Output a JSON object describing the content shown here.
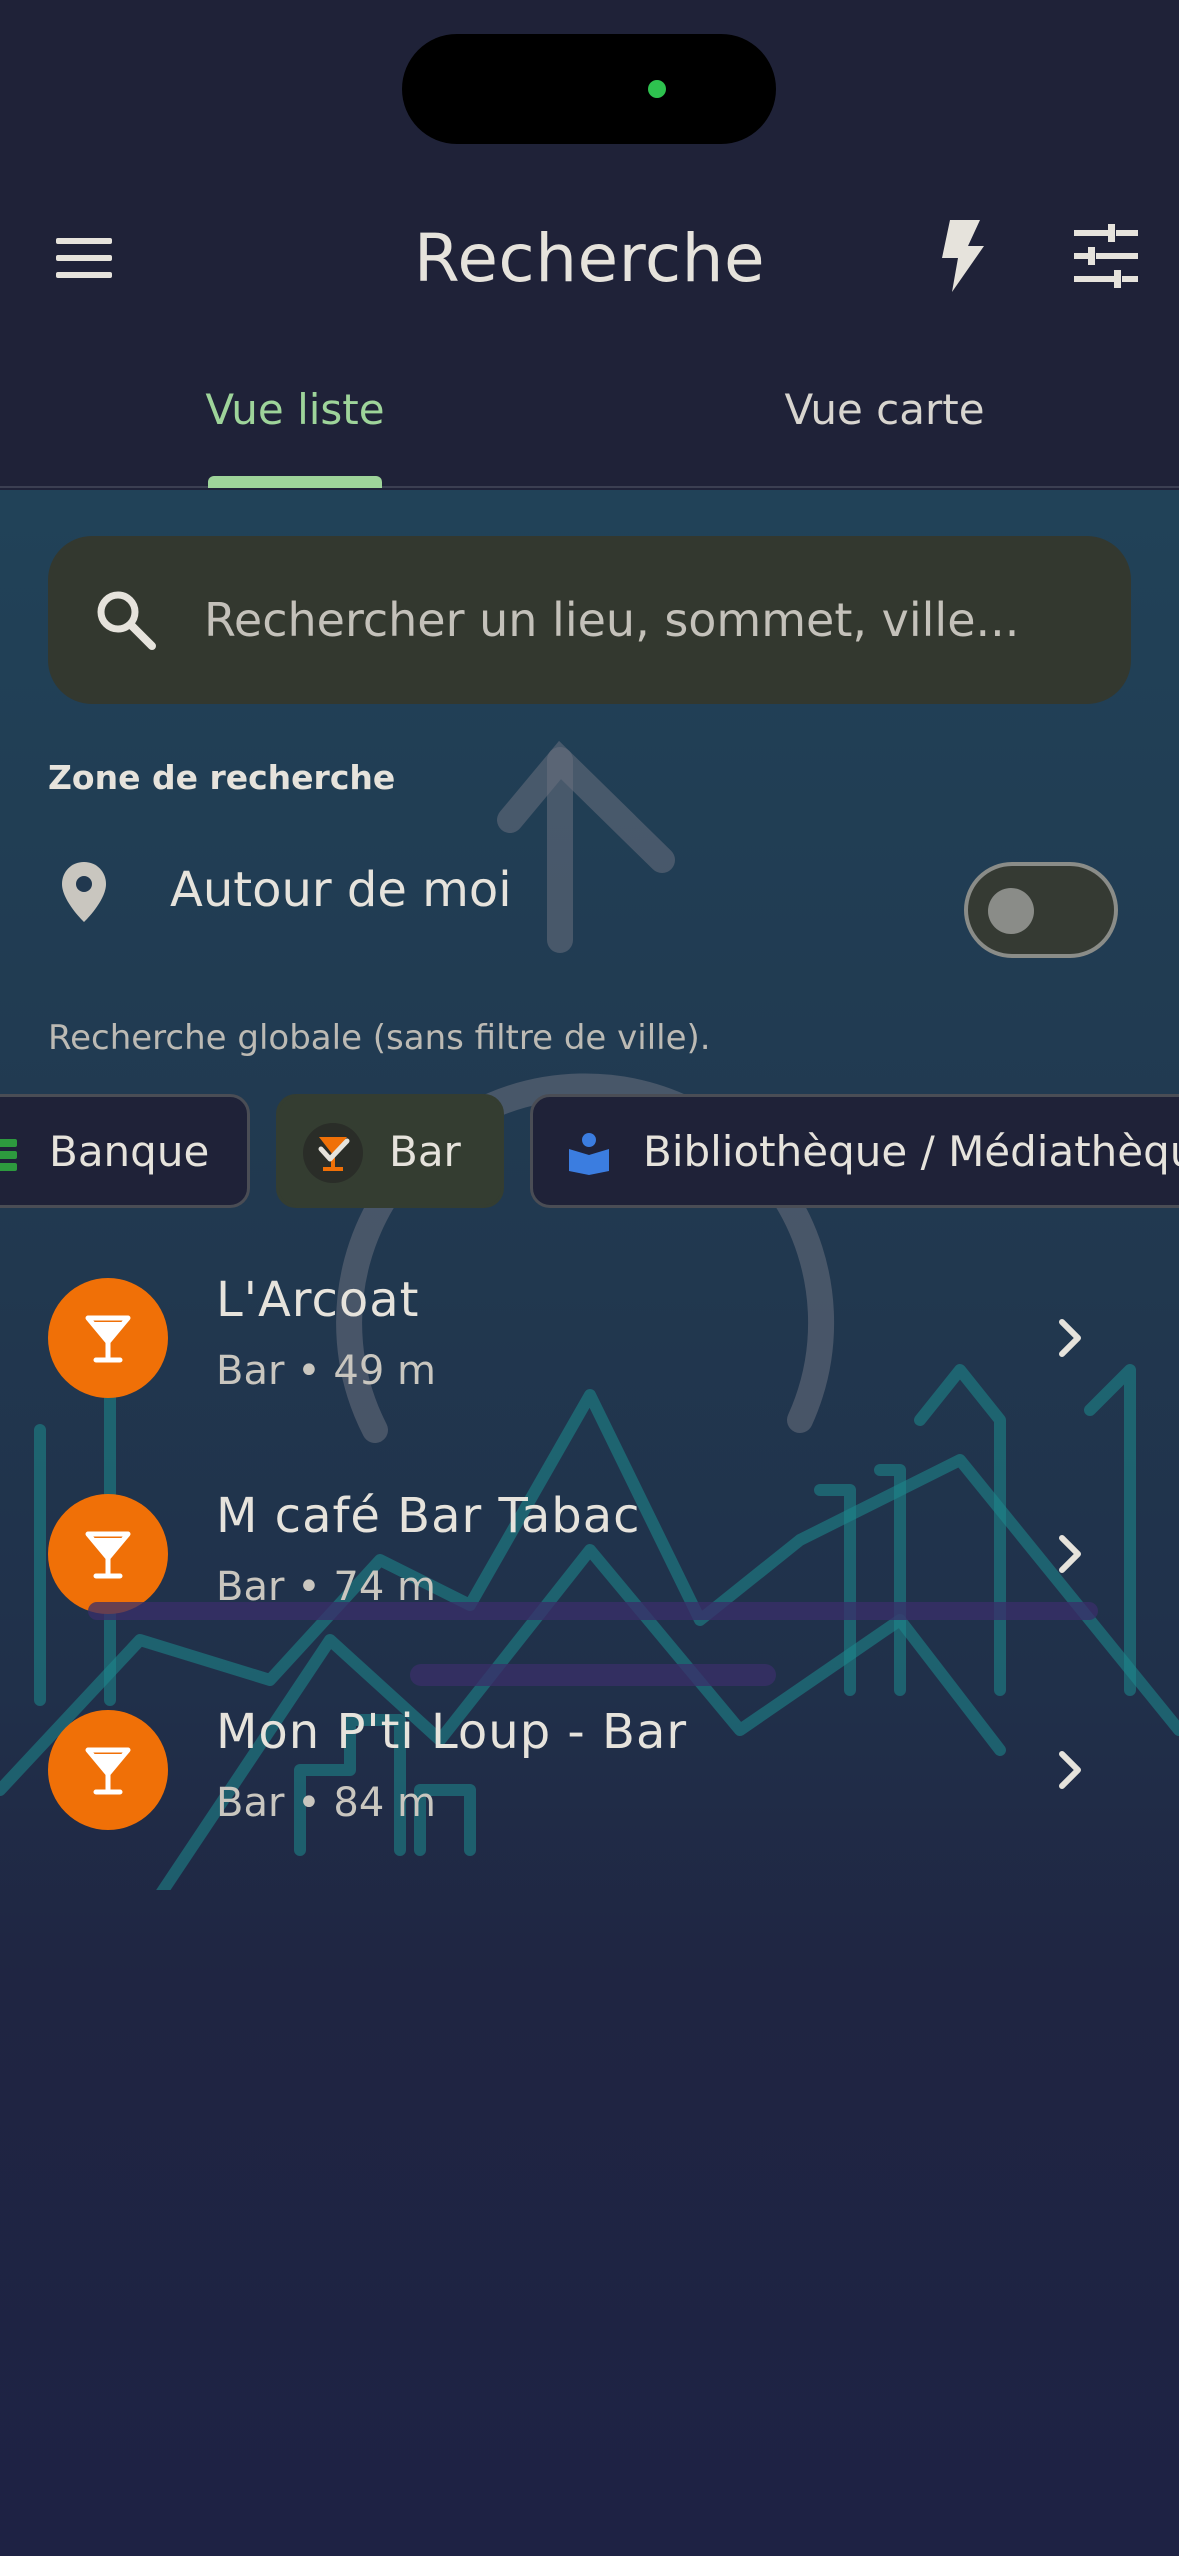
{
  "app": {
    "title": "Recherche"
  },
  "icons": {
    "menu": "menu-icon",
    "quick_action": "bolt-icon",
    "filters": "tune-icon",
    "search": "search-icon",
    "location": "location-pin-icon",
    "bank": "bank-icon",
    "bar": "cocktail-check-icon",
    "library": "book-reader-icon",
    "result": "cocktail-icon",
    "chevron": "chevron-right-icon"
  },
  "tabs": [
    {
      "label": "Vue liste",
      "selected": true
    },
    {
      "label": "Vue carte",
      "selected": false
    }
  ],
  "search": {
    "placeholder": "Rechercher un lieu, sommet, ville...",
    "value": ""
  },
  "zone": {
    "title": "Zone de recherche",
    "around_me_label": "Autour de moi",
    "around_me_enabled": false,
    "note": "Recherche globale (sans filtre de ville)."
  },
  "categories": [
    {
      "label": "Banque",
      "selected": false
    },
    {
      "label": "Bar",
      "selected": true
    },
    {
      "label": "Bibliothèque / Médiathèque",
      "selected": false
    }
  ],
  "results": [
    {
      "name": "L'Arcoat",
      "meta": "Bar • 49 m"
    },
    {
      "name": "M café Bar Tabac",
      "meta": "Bar • 74 m"
    },
    {
      "name": "Mon P'ti Loup - Bar",
      "meta": "Bar • 84 m"
    }
  ],
  "colors": {
    "background": "#1f2238",
    "accent": "#9ed49a",
    "result_avatar": "#f07007",
    "search_field": "#33382f",
    "selected_chip": "#343d31"
  }
}
